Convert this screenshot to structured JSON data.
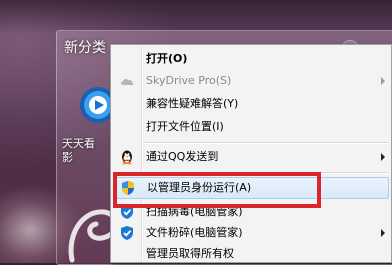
{
  "desktop": {
    "group_title": "新分类",
    "icon_label": "天天看\n影"
  },
  "menu": {
    "items": [
      {
        "label": "打开(O)",
        "bold": true
      },
      {
        "label": "SkyDrive Pro(S)",
        "disabled": true,
        "icon": "cloud-icon",
        "submenu": true
      },
      {
        "label": "兼容性疑难解答(Y)"
      },
      {
        "label": "打开文件位置(I)"
      },
      {
        "label": "通过QQ发送到",
        "icon": "qq-penguin-icon",
        "submenu": true
      },
      {
        "label": "以管理员身份运行(A)",
        "icon": "uac-shield-icon",
        "highlighted": true
      },
      {
        "label": "扫描病毒(电脑管家)",
        "icon": "tencent-shield-icon"
      },
      {
        "label": "文件粉碎(电脑管家)",
        "icon": "tencent-shield-icon",
        "submenu": true
      },
      {
        "label": "管理员取得所有权"
      }
    ]
  },
  "colors": {
    "menu_background": "#f3f3f3",
    "highlight_border": "#aecbe9",
    "annotation_red": "#d9262b",
    "qq_shield_blue": "#1e78d2"
  }
}
